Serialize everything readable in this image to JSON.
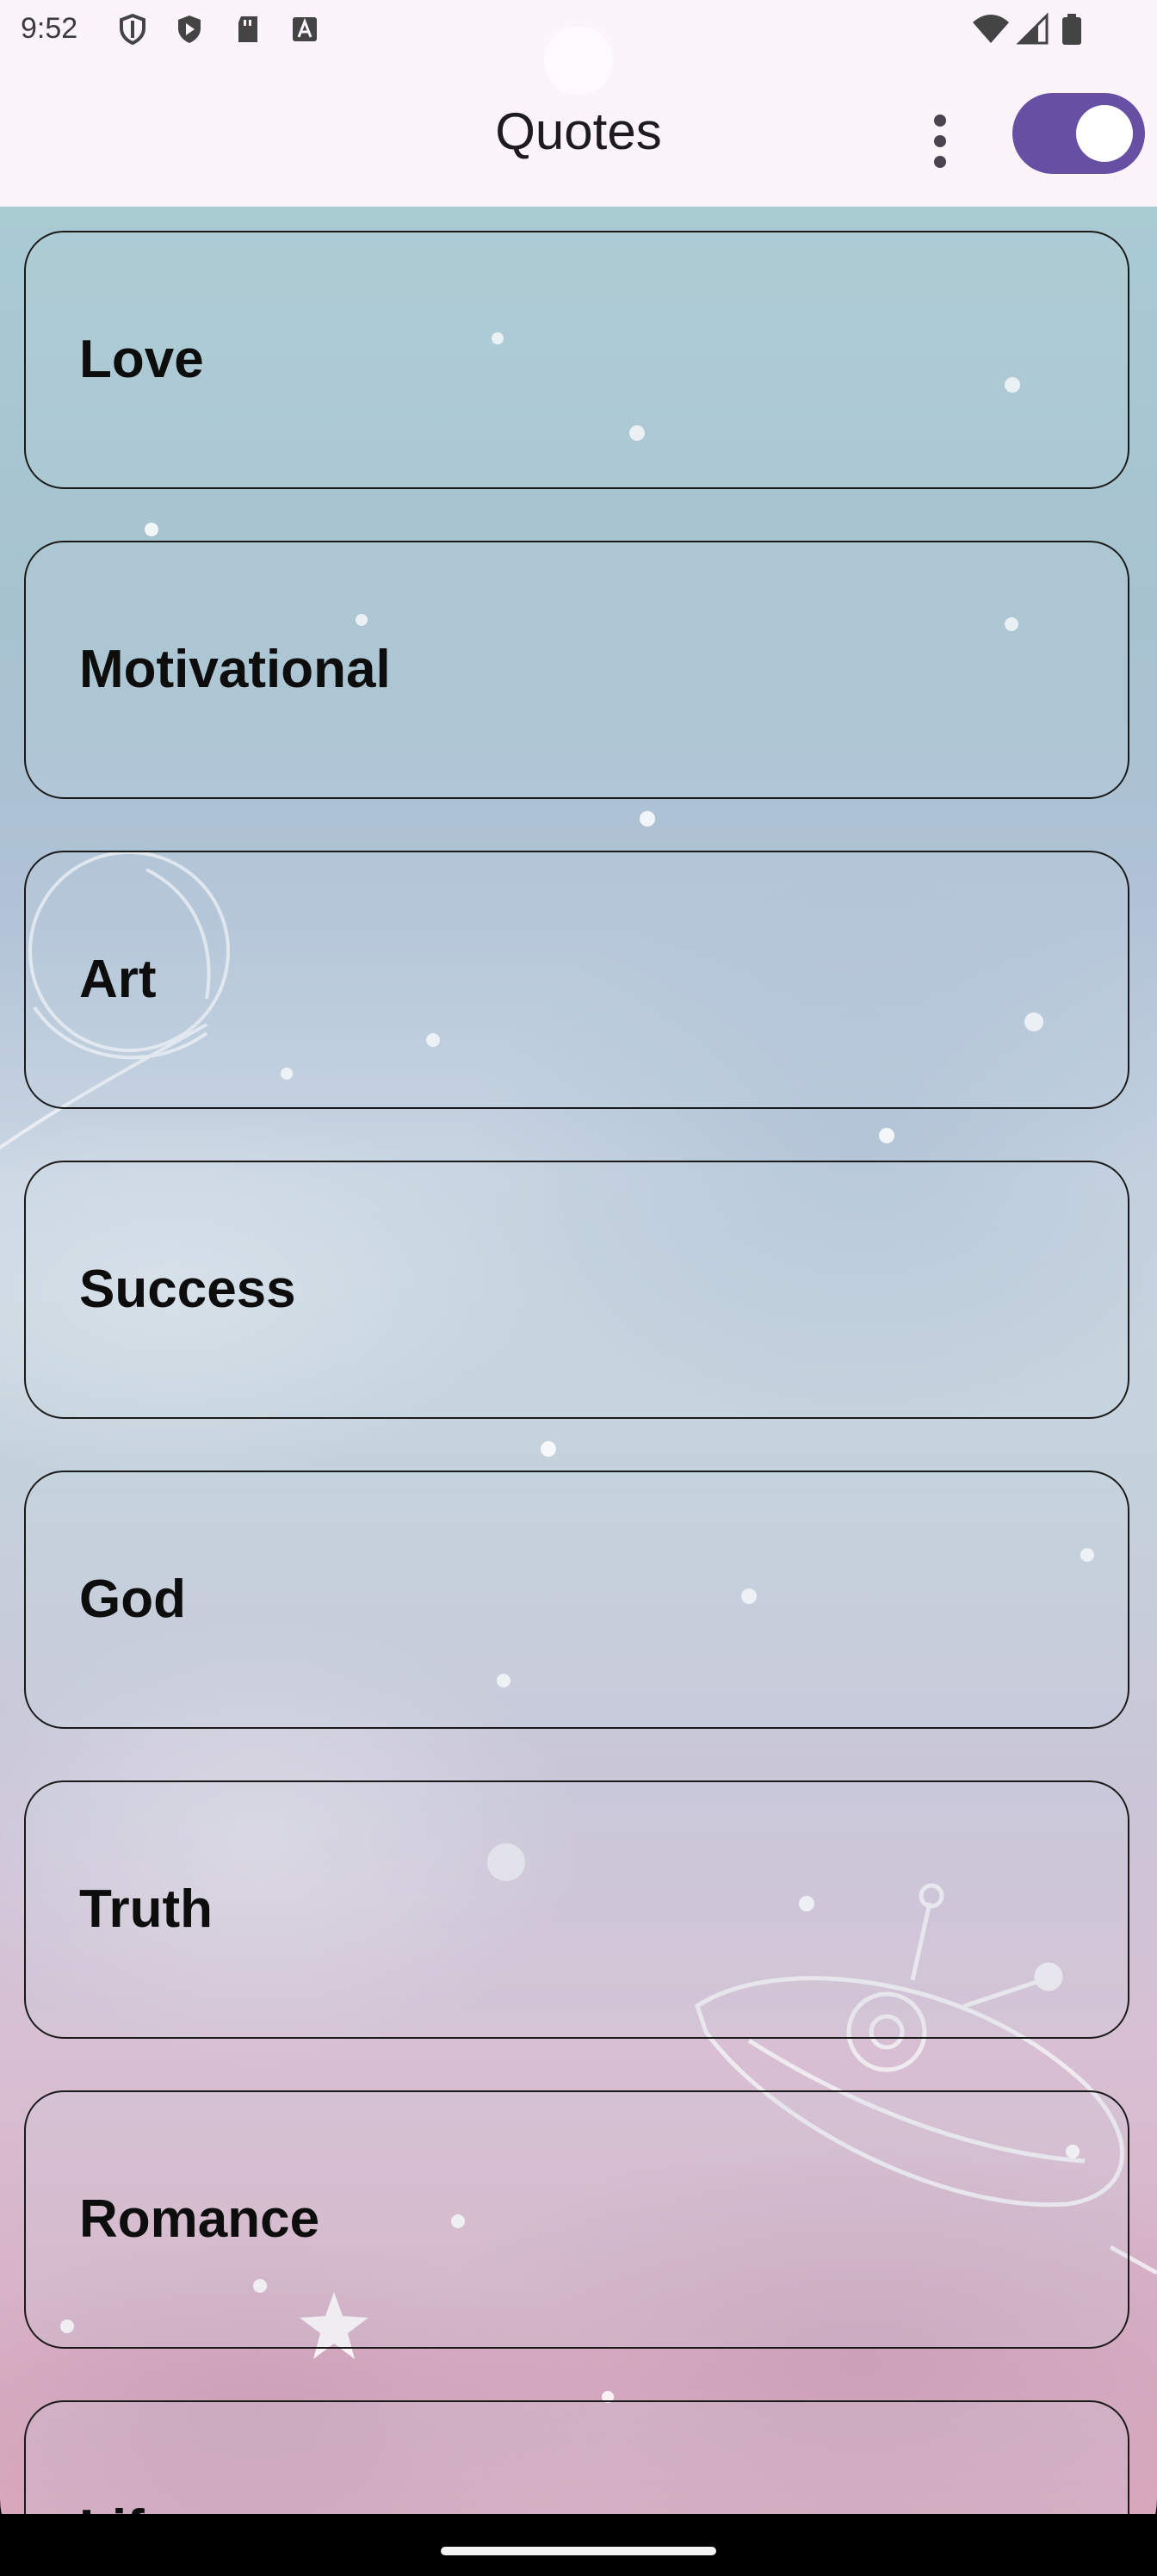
{
  "status_bar": {
    "time": "9:52",
    "left_icons": [
      "shield-icon",
      "play-shield-icon",
      "sd-card-icon",
      "keyboard-a-icon"
    ],
    "right_icons": [
      "wifi-icon",
      "signal-icon",
      "battery-icon"
    ]
  },
  "app_bar": {
    "title": "Quotes",
    "menu_icon": "more-vert-icon",
    "theme_toggle_on": true,
    "accent_color": "#6750a4"
  },
  "categories": [
    {
      "label": "Love"
    },
    {
      "label": "Motivational"
    },
    {
      "label": "Art"
    },
    {
      "label": "Success"
    },
    {
      "label": "God"
    },
    {
      "label": "Truth"
    },
    {
      "label": "Romance"
    },
    {
      "label": "Life"
    }
  ]
}
